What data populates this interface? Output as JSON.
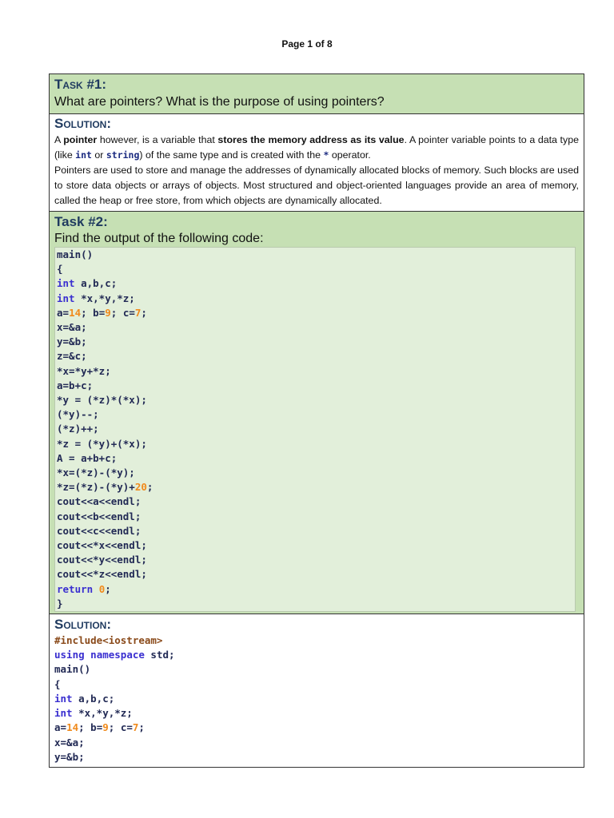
{
  "page_label": "Page 1 of 8",
  "task1": {
    "heading": "Task #1:",
    "question": "What are pointers? What is the purpose of using pointers?"
  },
  "solution1": {
    "heading": "Solution:",
    "p1_a": "A ",
    "p1_b": "pointer",
    "p1_c": " however, is a variable that ",
    "p1_d": "stores the memory address as its value",
    "p1_e": ". A pointer variable points to a data type (like ",
    "p1_f": "int",
    "p1_g": " or ",
    "p1_h": "string",
    "p1_i": ") of the same type and is created with the ",
    "p1_j": "*",
    "p1_k": " operator.",
    "p2": "Pointers are used to store and manage the addresses of dynamically allocated blocks of memory. Such blocks are used to store data objects or arrays of objects. Most structured and object-oriented languages provide an area of memory, called the heap or free store, from which objects are dynamically allocated."
  },
  "task2": {
    "heading": "Task #2:",
    "question": "Find the output of the following code:",
    "code": [
      [
        [
          "main()",
          "d"
        ]
      ],
      [
        [
          "{",
          "d"
        ]
      ],
      [
        [
          "int",
          "k"
        ],
        [
          " a,b,c;",
          "d"
        ]
      ],
      [
        [
          "int",
          "k"
        ],
        [
          " *x,*y,*z;",
          "d"
        ]
      ],
      [
        [
          "a=",
          "d"
        ],
        [
          "14",
          "n"
        ],
        [
          "; b=",
          "d"
        ],
        [
          "9",
          "n"
        ],
        [
          "; c=",
          "d"
        ],
        [
          "7",
          "n"
        ],
        [
          ";",
          "d"
        ]
      ],
      [
        [
          "x=&a;",
          "d"
        ]
      ],
      [
        [
          "y=&b;",
          "d"
        ]
      ],
      [
        [
          "z=&c;",
          "d"
        ]
      ],
      [
        [
          "*x=*y+*z;",
          "d"
        ]
      ],
      [
        [
          "a=b+c;",
          "d"
        ]
      ],
      [
        [
          "*y = (*z)*(*x);",
          "d"
        ]
      ],
      [
        [
          "(*y)--;",
          "d"
        ]
      ],
      [
        [
          "(*z)++;",
          "d"
        ]
      ],
      [
        [
          "*z = (*y)+(*x);",
          "d"
        ]
      ],
      [
        [
          "A = a+b+c;",
          "d"
        ]
      ],
      [
        [
          "*x=(*z)-(*y);",
          "d"
        ]
      ],
      [
        [
          "*z=(*z)-(*y)+",
          "d"
        ],
        [
          "20",
          "n"
        ],
        [
          ";",
          "d"
        ]
      ],
      [
        [
          "cout<<a<<endl;",
          "d"
        ]
      ],
      [
        [
          "cout<<b<<endl;",
          "d"
        ]
      ],
      [
        [
          "cout<<c<<endl;",
          "d"
        ]
      ],
      [
        [
          "cout<<*x<<endl;",
          "d"
        ]
      ],
      [
        [
          "cout<<*y<<endl;",
          "d"
        ]
      ],
      [
        [
          "cout<<*z<<endl;",
          "d"
        ]
      ],
      [
        [
          "return",
          "k"
        ],
        [
          " ",
          "d"
        ],
        [
          "0",
          "n"
        ],
        [
          ";",
          "d"
        ]
      ],
      [
        [
          "}",
          "d"
        ]
      ]
    ]
  },
  "solution2": {
    "heading": "Solution:",
    "code": [
      [
        [
          "#include<iostream>",
          "p"
        ]
      ],
      [
        [
          "using",
          "k"
        ],
        [
          " ",
          "d"
        ],
        [
          "namespace",
          "k"
        ],
        [
          " std;",
          "d"
        ]
      ],
      [
        [
          "main()",
          "d"
        ]
      ],
      [
        [
          "{",
          "d"
        ]
      ],
      [
        [
          "int",
          "k"
        ],
        [
          " a,b,c;",
          "d"
        ]
      ],
      [
        [
          "int",
          "k"
        ],
        [
          " *x,*y,*z;",
          "d"
        ]
      ],
      [
        [
          "a=",
          "d"
        ],
        [
          "14",
          "n"
        ],
        [
          "; b=",
          "d"
        ],
        [
          "9",
          "n"
        ],
        [
          "; c=",
          "d"
        ],
        [
          "7",
          "n"
        ],
        [
          ";",
          "d"
        ]
      ],
      [
        [
          "x=&a;",
          "d"
        ]
      ],
      [
        [
          "y=&b;",
          "d"
        ]
      ]
    ]
  },
  "colors": {
    "header_bg": "#c6e0b4",
    "code_bg": "#e2efda",
    "heading": "#1f3a5f",
    "keyword": "#3a2fd0",
    "number": "#f08a1c"
  }
}
